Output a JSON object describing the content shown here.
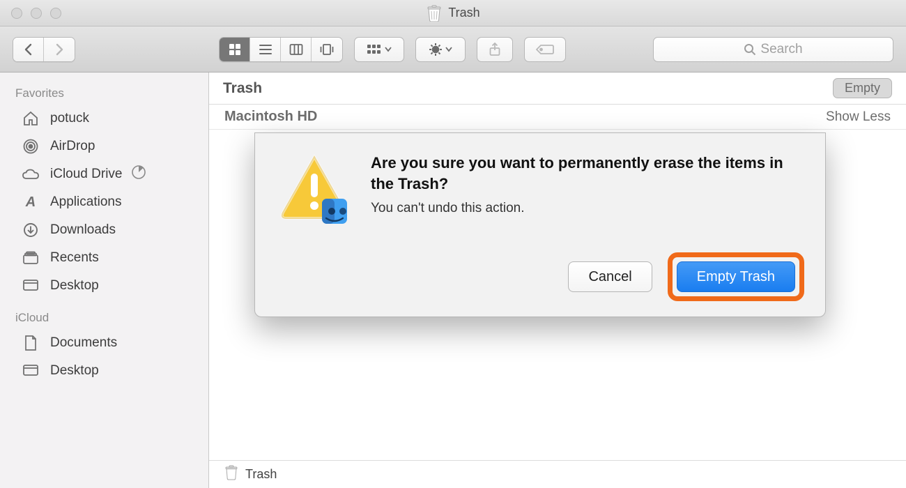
{
  "window": {
    "title": "Trash"
  },
  "toolbar": {
    "search_placeholder": "Search"
  },
  "sidebar": {
    "sections": [
      {
        "title": "Favorites",
        "items": [
          {
            "icon": "home-icon",
            "label": "potuck"
          },
          {
            "icon": "airdrop-icon",
            "label": "AirDrop"
          },
          {
            "icon": "icloud-icon",
            "label": "iCloud Drive",
            "badge": true
          },
          {
            "icon": "applications-icon",
            "label": "Applications"
          },
          {
            "icon": "downloads-icon",
            "label": "Downloads"
          },
          {
            "icon": "recents-icon",
            "label": "Recents"
          },
          {
            "icon": "desktop-icon",
            "label": "Desktop"
          }
        ]
      },
      {
        "title": "iCloud",
        "items": [
          {
            "icon": "document-icon",
            "label": "Documents"
          },
          {
            "icon": "desktop-icon",
            "label": "Desktop"
          }
        ]
      }
    ]
  },
  "main": {
    "location_title": "Trash",
    "empty_button": "Empty",
    "volume": "Macintosh HD",
    "show_less": "Show Less",
    "footer_path": "Trash"
  },
  "dialog": {
    "heading": "Are you sure you want to permanently erase the items in the Trash?",
    "message": "You can't undo this action.",
    "cancel": "Cancel",
    "confirm": "Empty Trash"
  }
}
